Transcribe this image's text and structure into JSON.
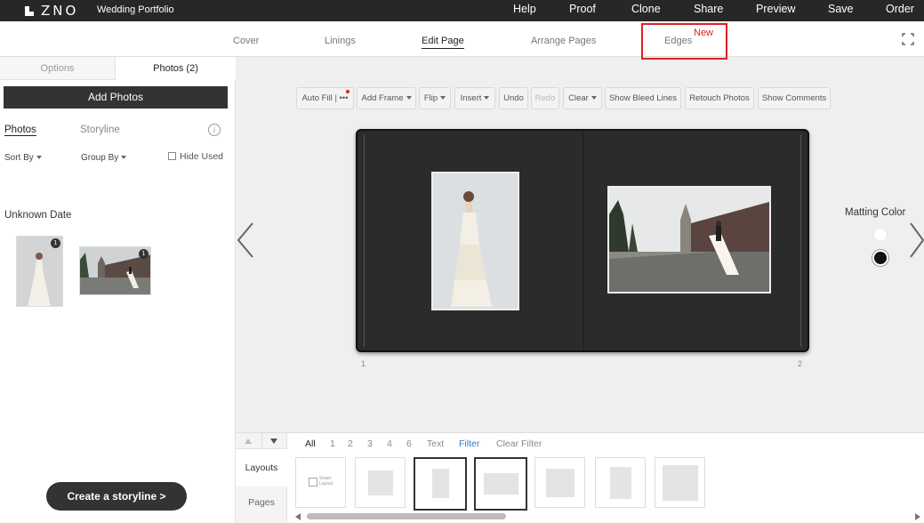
{
  "topbar": {
    "logo": "ZNO",
    "title": "Wedding Portfolio",
    "menu": [
      "Help",
      "Proof",
      "Clone",
      "Share",
      "Preview",
      "Save",
      "Order"
    ]
  },
  "tabs": {
    "items": [
      "Cover",
      "Linings",
      "Edit Page",
      "Arrange Pages",
      "Edges"
    ],
    "active": "Edit Page",
    "new_badge": "New"
  },
  "left_panel": {
    "tab_options": "Options",
    "tab_photos": "Photos (2)",
    "add_photos": "Add Photos",
    "photos_tab": "Photos",
    "storyline_tab": "Storyline",
    "info": "i",
    "sort_by": "Sort By",
    "group_by": "Group By",
    "hide_used": "Hide Used",
    "group_label": "Unknown Date",
    "thumb_badges": [
      "1",
      "1"
    ],
    "create_storyline": "Create a storyline >"
  },
  "toolbar": {
    "auto_fill": "Auto Fill",
    "more": "|  •••",
    "add_frame": "Add Frame",
    "flip": "Flip",
    "insert": "Insert",
    "undo": "Undo",
    "redo": "Redo",
    "clear": "Clear",
    "show_bleed_lines": "Show Bleed Lines",
    "retouch_photos": "Retouch Photos",
    "show_comments": "Show Comments"
  },
  "spread": {
    "page_left": "1",
    "page_right": "2"
  },
  "matting": {
    "label": "Matting Color",
    "colors": [
      "#ffffff",
      "#111111"
    ],
    "selected": "#111111"
  },
  "bottom": {
    "layouts_tab": "Layouts",
    "pages_tab": "Pages",
    "filters": [
      "All",
      "1",
      "2",
      "3",
      "4",
      "6",
      "Text",
      "Filter",
      "Clear Filter"
    ],
    "smart_layout": "Smart Layout"
  },
  "colors": {
    "topbar": "#272727",
    "accent_red": "#e02020",
    "filter_blue": "#2a7fd4"
  }
}
